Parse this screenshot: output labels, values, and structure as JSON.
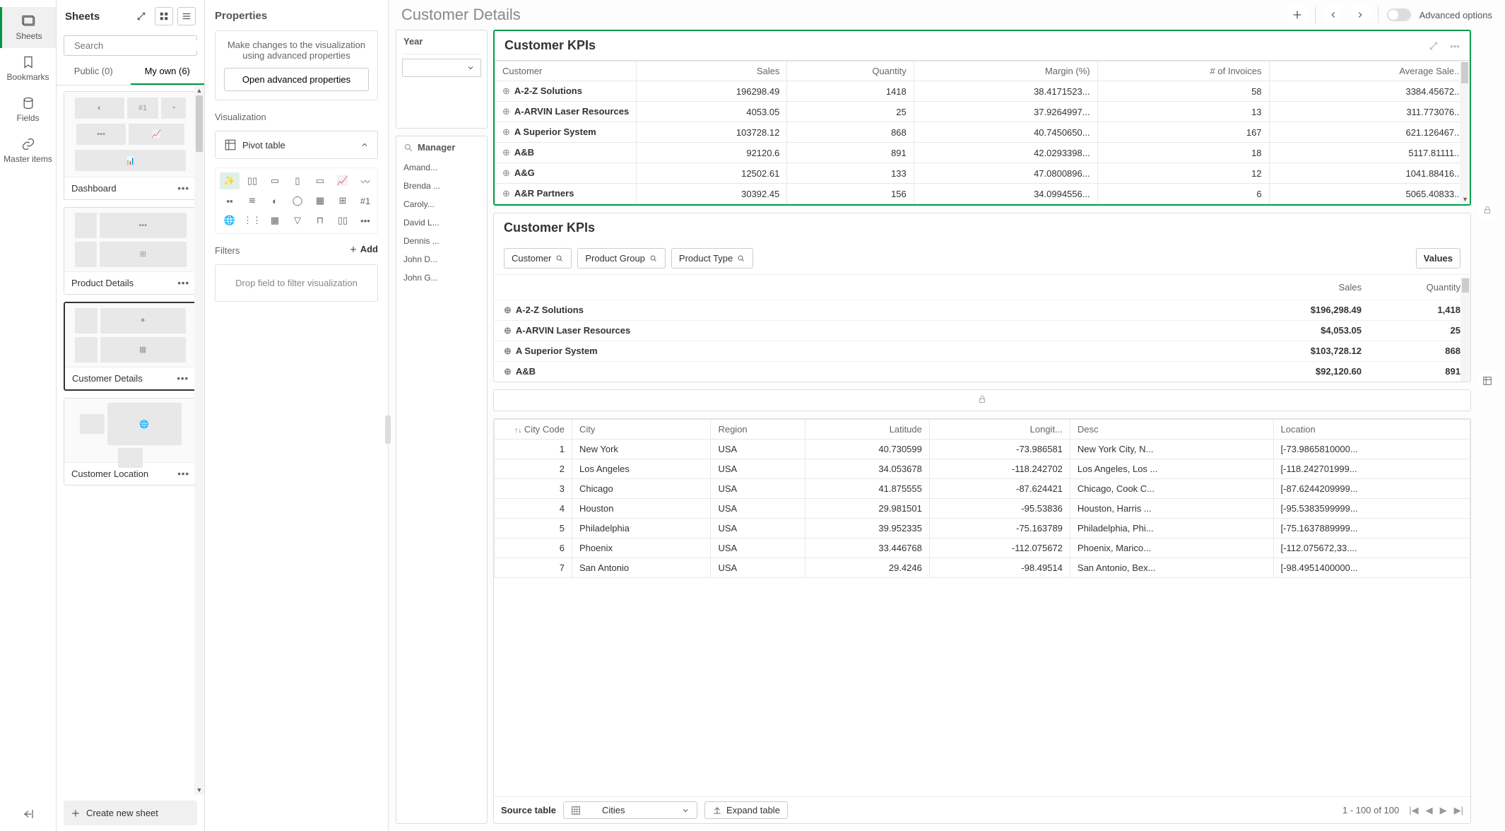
{
  "rail": {
    "sheets": "Sheets",
    "bookmarks": "Bookmarks",
    "fields": "Fields",
    "master": "Master items"
  },
  "sheets": {
    "title": "Sheets",
    "search_placeholder": "Search",
    "tabs": {
      "public": "Public (0)",
      "myown": "My own (6)"
    },
    "cards": [
      {
        "name": "Dashboard"
      },
      {
        "name": "Product Details"
      },
      {
        "name": "Customer Details"
      },
      {
        "name": "Customer Location"
      }
    ],
    "create": "Create new sheet"
  },
  "props": {
    "title": "Properties",
    "hint": "Make changes to the visualization using advanced properties",
    "adv_btn": "Open advanced properties",
    "viz_label": "Visualization",
    "viz_value": "Pivot table",
    "filters_label": "Filters",
    "add": "Add",
    "drop": "Drop field to filter visualization"
  },
  "canvas": {
    "title": "Customer Details",
    "advanced": "Advanced options",
    "year_label": "Year",
    "manager_label": "Manager",
    "managers": [
      "Amand...",
      "Brenda ...",
      "Caroly...",
      "David L...",
      "Dennis ...",
      "John D...",
      "John G..."
    ],
    "kpi_title": "Customer KPIs",
    "kpi_cols": [
      "Customer",
      "Sales",
      "Quantity",
      "Margin (%)",
      "# of Invoices",
      "Average Sale..."
    ],
    "kpi_rows": [
      {
        "c": "A-2-Z Solutions",
        "s": "196298.49",
        "q": "1418",
        "m": "38.4171523...",
        "i": "58",
        "a": "3384.45672..."
      },
      {
        "c": "A-ARVIN Laser Resources",
        "s": "4053.05",
        "q": "25",
        "m": "37.9264997...",
        "i": "13",
        "a": "311.773076..."
      },
      {
        "c": "A Superior System",
        "s": "103728.12",
        "q": "868",
        "m": "40.7450650...",
        "i": "167",
        "a": "621.126467..."
      },
      {
        "c": "A&B",
        "s": "92120.6",
        "q": "891",
        "m": "42.0293398...",
        "i": "18",
        "a": "5117.81111..."
      },
      {
        "c": "A&G",
        "s": "12502.61",
        "q": "133",
        "m": "47.0800896...",
        "i": "12",
        "a": "1041.88416..."
      },
      {
        "c": "A&R Partners",
        "s": "30392.45",
        "q": "156",
        "m": "34.0994556...",
        "i": "6",
        "a": "5065.40833..."
      }
    ],
    "chips": {
      "customer": "Customer",
      "pg": "Product Group",
      "pt": "Product Type",
      "values": "Values"
    },
    "pivot_cols": [
      "Sales",
      "Quantity"
    ],
    "pivot_rows": [
      {
        "c": "A-2-Z Solutions",
        "s": "$196,298.49",
        "q": "1,418"
      },
      {
        "c": "A-ARVIN Laser Resources",
        "s": "$4,053.05",
        "q": "25"
      },
      {
        "c": "A Superior System",
        "s": "$103,728.12",
        "q": "868"
      },
      {
        "c": "A&B",
        "s": "$92,120.60",
        "q": "891"
      }
    ],
    "grid_cols": [
      "City Code",
      "City",
      "Region",
      "Latitude",
      "Longit...",
      "Desc",
      "Location"
    ],
    "grid_rows": [
      {
        "n": "1",
        "city": "New York",
        "r": "USA",
        "lat": "40.730599",
        "lon": "-73.986581",
        "d": "New York City, N...",
        "loc": "[-73.9865810000..."
      },
      {
        "n": "2",
        "city": "Los Angeles",
        "r": "USA",
        "lat": "34.053678",
        "lon": "-118.242702",
        "d": "Los Angeles, Los ...",
        "loc": "[-118.242701999..."
      },
      {
        "n": "3",
        "city": "Chicago",
        "r": "USA",
        "lat": "41.875555",
        "lon": "-87.624421",
        "d": "Chicago, Cook C...",
        "loc": "[-87.6244209999..."
      },
      {
        "n": "4",
        "city": "Houston",
        "r": "USA",
        "lat": "29.981501",
        "lon": "-95.53836",
        "d": "Houston, Harris ...",
        "loc": "[-95.5383599999..."
      },
      {
        "n": "5",
        "city": "Philadelphia",
        "r": "USA",
        "lat": "39.952335",
        "lon": "-75.163789",
        "d": "Philadelphia, Phi...",
        "loc": "[-75.1637889999..."
      },
      {
        "n": "6",
        "city": "Phoenix",
        "r": "USA",
        "lat": "33.446768",
        "lon": "-112.075672",
        "d": "Phoenix, Marico...",
        "loc": "[-112.075672,33...."
      },
      {
        "n": "7",
        "city": "San Antonio",
        "r": "USA",
        "lat": "29.4246",
        "lon": "-98.49514",
        "d": "San Antonio, Bex...",
        "loc": "[-98.4951400000..."
      }
    ],
    "source_label": "Source table",
    "source_value": "Cities",
    "expand": "Expand table",
    "pager": "1 - 100 of 100"
  }
}
